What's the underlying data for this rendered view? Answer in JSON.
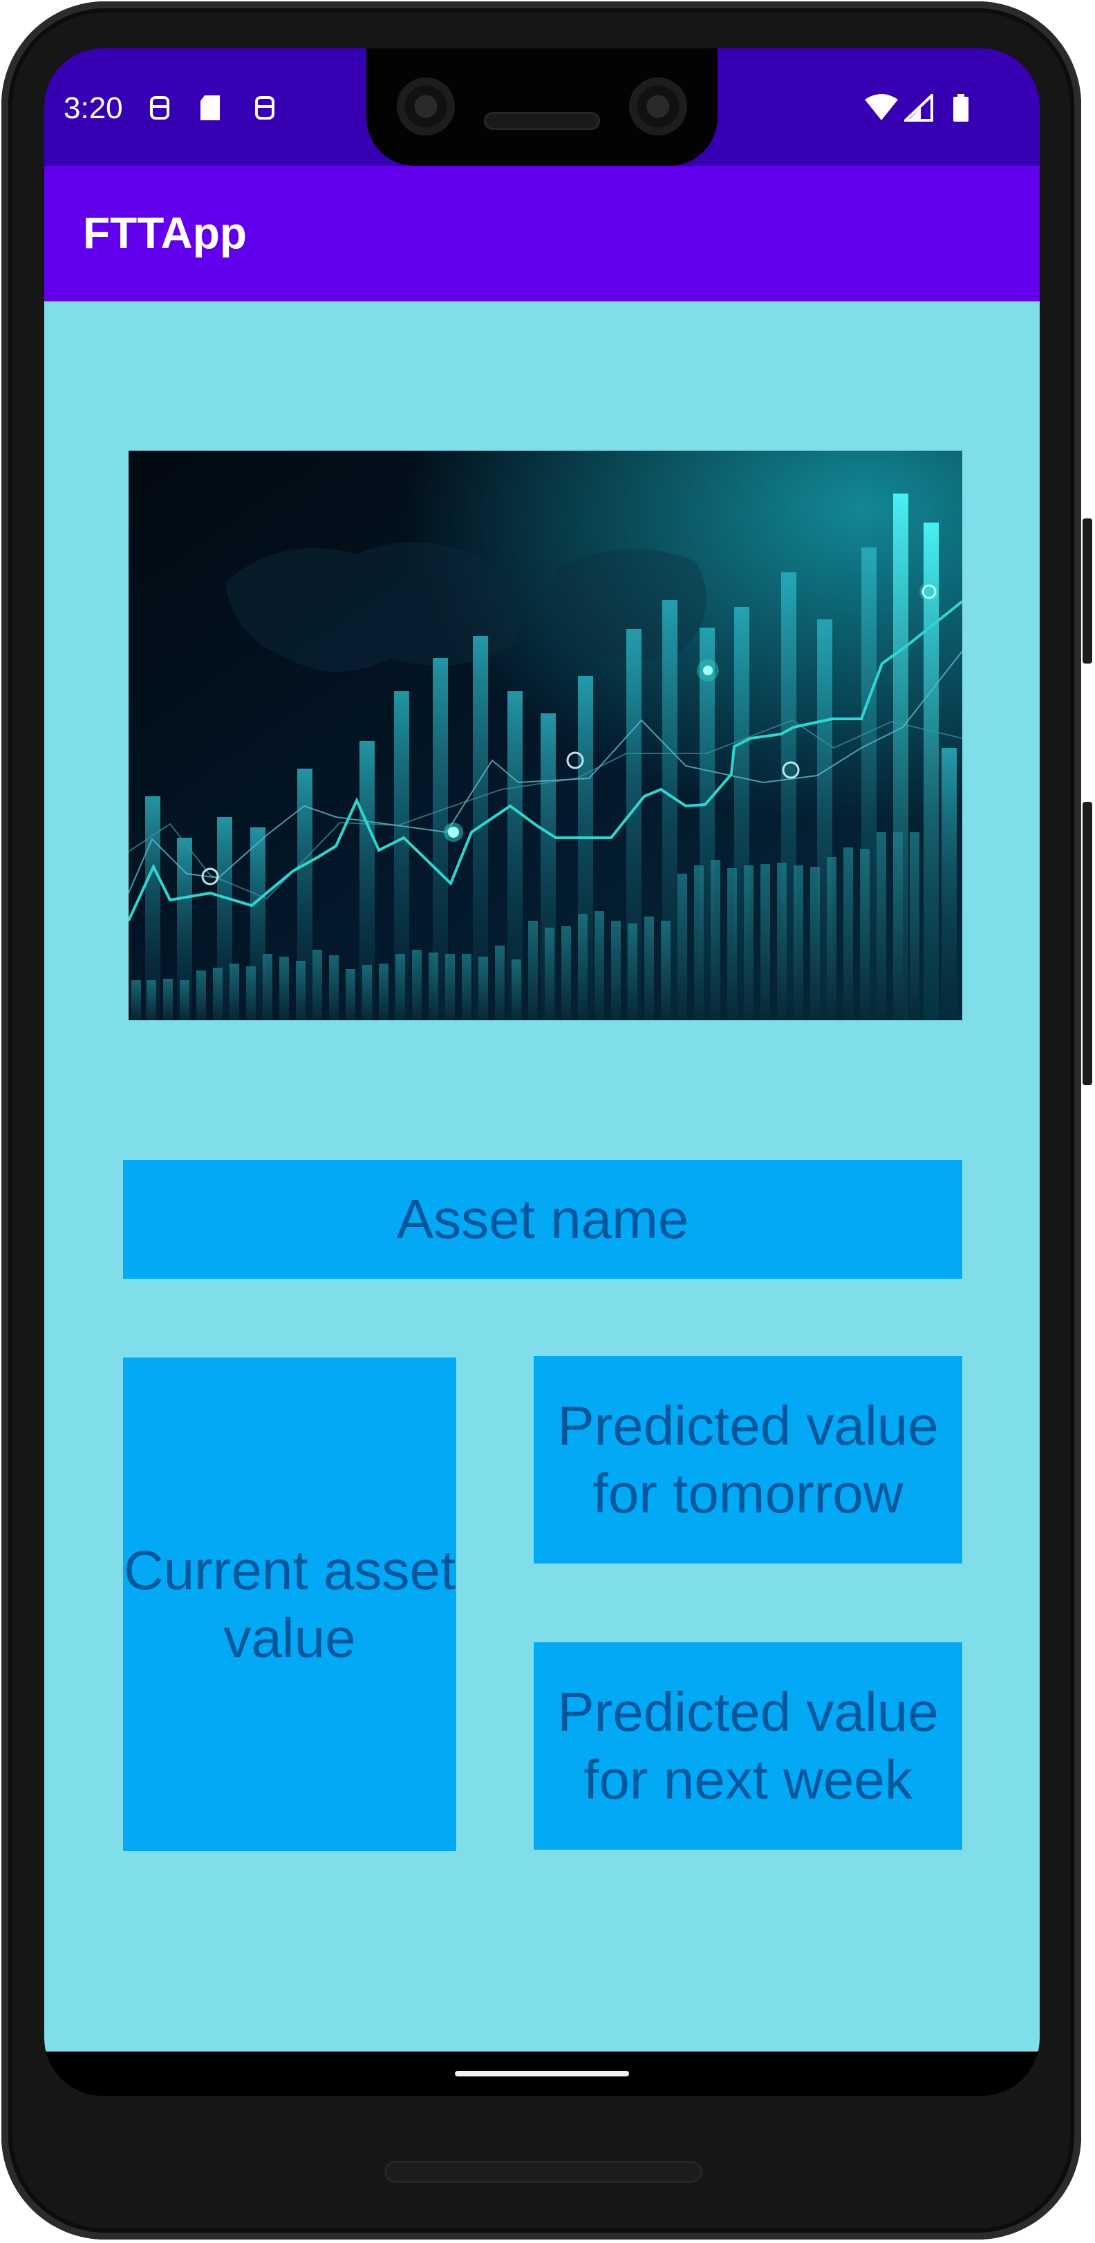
{
  "status_bar": {
    "time": "3:20",
    "left_icons": [
      "notification-icon",
      "sd-card-icon",
      "notification-icon"
    ],
    "right_icons": [
      "wifi-icon",
      "cell-signal-icon",
      "battery-icon"
    ]
  },
  "app_bar": {
    "title": "FTTApp",
    "color": "#6200ee",
    "status_color": "#3800b3"
  },
  "hero_image": {
    "icon": "stock-chart-image"
  },
  "cards": {
    "asset_name": "Asset name",
    "current_value": "Current asset value",
    "predicted_tomorrow": "Predicted value for tomorrow",
    "predicted_next_week": "Predicted value for next week"
  },
  "colors": {
    "background": "#80deea",
    "card": "#03a9f4",
    "card_text": "#01579b"
  }
}
